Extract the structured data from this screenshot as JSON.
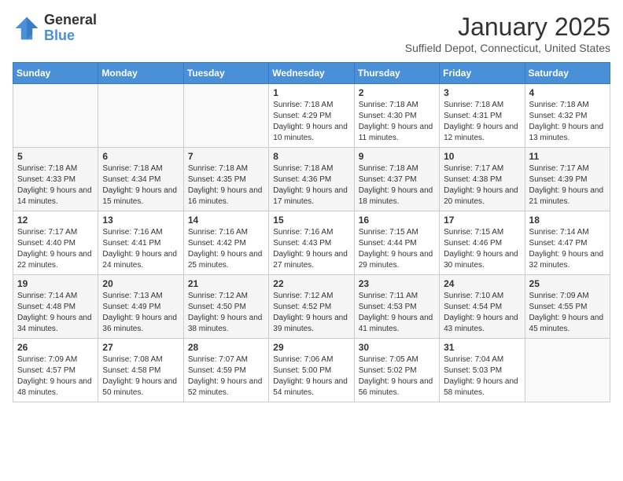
{
  "header": {
    "logo_general": "General",
    "logo_blue": "Blue",
    "month_year": "January 2025",
    "location": "Suffield Depot, Connecticut, United States"
  },
  "days_of_week": [
    "Sunday",
    "Monday",
    "Tuesday",
    "Wednesday",
    "Thursday",
    "Friday",
    "Saturday"
  ],
  "weeks": [
    [
      {
        "day": "",
        "sunrise": "",
        "sunset": "",
        "daylight": ""
      },
      {
        "day": "",
        "sunrise": "",
        "sunset": "",
        "daylight": ""
      },
      {
        "day": "",
        "sunrise": "",
        "sunset": "",
        "daylight": ""
      },
      {
        "day": "1",
        "sunrise": "Sunrise: 7:18 AM",
        "sunset": "Sunset: 4:29 PM",
        "daylight": "Daylight: 9 hours and 10 minutes."
      },
      {
        "day": "2",
        "sunrise": "Sunrise: 7:18 AM",
        "sunset": "Sunset: 4:30 PM",
        "daylight": "Daylight: 9 hours and 11 minutes."
      },
      {
        "day": "3",
        "sunrise": "Sunrise: 7:18 AM",
        "sunset": "Sunset: 4:31 PM",
        "daylight": "Daylight: 9 hours and 12 minutes."
      },
      {
        "day": "4",
        "sunrise": "Sunrise: 7:18 AM",
        "sunset": "Sunset: 4:32 PM",
        "daylight": "Daylight: 9 hours and 13 minutes."
      }
    ],
    [
      {
        "day": "5",
        "sunrise": "Sunrise: 7:18 AM",
        "sunset": "Sunset: 4:33 PM",
        "daylight": "Daylight: 9 hours and 14 minutes."
      },
      {
        "day": "6",
        "sunrise": "Sunrise: 7:18 AM",
        "sunset": "Sunset: 4:34 PM",
        "daylight": "Daylight: 9 hours and 15 minutes."
      },
      {
        "day": "7",
        "sunrise": "Sunrise: 7:18 AM",
        "sunset": "Sunset: 4:35 PM",
        "daylight": "Daylight: 9 hours and 16 minutes."
      },
      {
        "day": "8",
        "sunrise": "Sunrise: 7:18 AM",
        "sunset": "Sunset: 4:36 PM",
        "daylight": "Daylight: 9 hours and 17 minutes."
      },
      {
        "day": "9",
        "sunrise": "Sunrise: 7:18 AM",
        "sunset": "Sunset: 4:37 PM",
        "daylight": "Daylight: 9 hours and 18 minutes."
      },
      {
        "day": "10",
        "sunrise": "Sunrise: 7:17 AM",
        "sunset": "Sunset: 4:38 PM",
        "daylight": "Daylight: 9 hours and 20 minutes."
      },
      {
        "day": "11",
        "sunrise": "Sunrise: 7:17 AM",
        "sunset": "Sunset: 4:39 PM",
        "daylight": "Daylight: 9 hours and 21 minutes."
      }
    ],
    [
      {
        "day": "12",
        "sunrise": "Sunrise: 7:17 AM",
        "sunset": "Sunset: 4:40 PM",
        "daylight": "Daylight: 9 hours and 22 minutes."
      },
      {
        "day": "13",
        "sunrise": "Sunrise: 7:16 AM",
        "sunset": "Sunset: 4:41 PM",
        "daylight": "Daylight: 9 hours and 24 minutes."
      },
      {
        "day": "14",
        "sunrise": "Sunrise: 7:16 AM",
        "sunset": "Sunset: 4:42 PM",
        "daylight": "Daylight: 9 hours and 25 minutes."
      },
      {
        "day": "15",
        "sunrise": "Sunrise: 7:16 AM",
        "sunset": "Sunset: 4:43 PM",
        "daylight": "Daylight: 9 hours and 27 minutes."
      },
      {
        "day": "16",
        "sunrise": "Sunrise: 7:15 AM",
        "sunset": "Sunset: 4:44 PM",
        "daylight": "Daylight: 9 hours and 29 minutes."
      },
      {
        "day": "17",
        "sunrise": "Sunrise: 7:15 AM",
        "sunset": "Sunset: 4:46 PM",
        "daylight": "Daylight: 9 hours and 30 minutes."
      },
      {
        "day": "18",
        "sunrise": "Sunrise: 7:14 AM",
        "sunset": "Sunset: 4:47 PM",
        "daylight": "Daylight: 9 hours and 32 minutes."
      }
    ],
    [
      {
        "day": "19",
        "sunrise": "Sunrise: 7:14 AM",
        "sunset": "Sunset: 4:48 PM",
        "daylight": "Daylight: 9 hours and 34 minutes."
      },
      {
        "day": "20",
        "sunrise": "Sunrise: 7:13 AM",
        "sunset": "Sunset: 4:49 PM",
        "daylight": "Daylight: 9 hours and 36 minutes."
      },
      {
        "day": "21",
        "sunrise": "Sunrise: 7:12 AM",
        "sunset": "Sunset: 4:50 PM",
        "daylight": "Daylight: 9 hours and 38 minutes."
      },
      {
        "day": "22",
        "sunrise": "Sunrise: 7:12 AM",
        "sunset": "Sunset: 4:52 PM",
        "daylight": "Daylight: 9 hours and 39 minutes."
      },
      {
        "day": "23",
        "sunrise": "Sunrise: 7:11 AM",
        "sunset": "Sunset: 4:53 PM",
        "daylight": "Daylight: 9 hours and 41 minutes."
      },
      {
        "day": "24",
        "sunrise": "Sunrise: 7:10 AM",
        "sunset": "Sunset: 4:54 PM",
        "daylight": "Daylight: 9 hours and 43 minutes."
      },
      {
        "day": "25",
        "sunrise": "Sunrise: 7:09 AM",
        "sunset": "Sunset: 4:55 PM",
        "daylight": "Daylight: 9 hours and 45 minutes."
      }
    ],
    [
      {
        "day": "26",
        "sunrise": "Sunrise: 7:09 AM",
        "sunset": "Sunset: 4:57 PM",
        "daylight": "Daylight: 9 hours and 48 minutes."
      },
      {
        "day": "27",
        "sunrise": "Sunrise: 7:08 AM",
        "sunset": "Sunset: 4:58 PM",
        "daylight": "Daylight: 9 hours and 50 minutes."
      },
      {
        "day": "28",
        "sunrise": "Sunrise: 7:07 AM",
        "sunset": "Sunset: 4:59 PM",
        "daylight": "Daylight: 9 hours and 52 minutes."
      },
      {
        "day": "29",
        "sunrise": "Sunrise: 7:06 AM",
        "sunset": "Sunset: 5:00 PM",
        "daylight": "Daylight: 9 hours and 54 minutes."
      },
      {
        "day": "30",
        "sunrise": "Sunrise: 7:05 AM",
        "sunset": "Sunset: 5:02 PM",
        "daylight": "Daylight: 9 hours and 56 minutes."
      },
      {
        "day": "31",
        "sunrise": "Sunrise: 7:04 AM",
        "sunset": "Sunset: 5:03 PM",
        "daylight": "Daylight: 9 hours and 58 minutes."
      },
      {
        "day": "",
        "sunrise": "",
        "sunset": "",
        "daylight": ""
      }
    ]
  ]
}
